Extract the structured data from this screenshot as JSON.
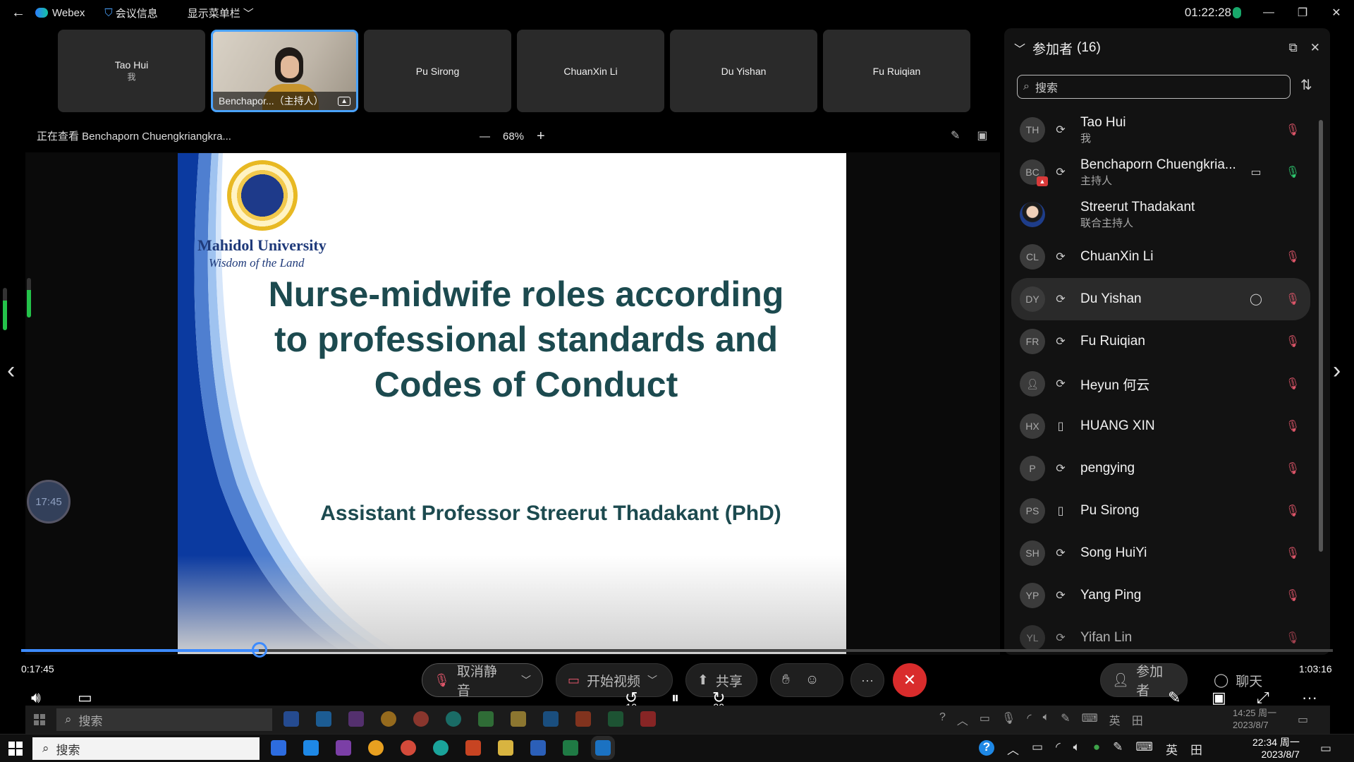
{
  "topbar": {
    "back_icon": "back-arrow-icon",
    "app_name": "Webex",
    "meeting_info": "会议信息",
    "show_menu": "显示菜单栏",
    "time": "01:22:28"
  },
  "thumbnails": [
    {
      "name": "Tao Hui",
      "sub": "我"
    },
    {
      "name": "Benchapor...（主持人）",
      "sub": ""
    },
    {
      "name": "Pu Sirong",
      "sub": ""
    },
    {
      "name": "ChuanXin Li",
      "sub": ""
    },
    {
      "name": "Du Yishan",
      "sub": ""
    },
    {
      "name": "Fu Ruiqian",
      "sub": ""
    }
  ],
  "view": {
    "viewing": "正在查看 Benchaporn Chuengkriangkra...",
    "zoom": "68%"
  },
  "slide": {
    "university": "Mahidol University",
    "motto": "Wisdom of the Land",
    "title_lines": [
      "Nurse-midwife roles according",
      "to professional standards and",
      "Codes of Conduct"
    ],
    "author": "Assistant Professor Streerut Thadakant (PhD)"
  },
  "timer_bubble": "17:45",
  "panel": {
    "title": "参加者",
    "count": "(16)",
    "search_placeholder": "搜索",
    "participants": [
      {
        "initials": "TH",
        "name": "Tao Hui",
        "role": "我",
        "device": "sync",
        "mic": "muted"
      },
      {
        "initials": "BC",
        "name": "Benchaporn Chuengkria...",
        "role": "主持人",
        "device": "sync",
        "mic": "on",
        "extra": "video"
      },
      {
        "initials": "",
        "name": "Streerut Thadakant",
        "role": "联合主持人",
        "device": "",
        "mic": ""
      },
      {
        "initials": "CL",
        "name": "ChuanXin Li",
        "role": "",
        "device": "sync",
        "mic": "muted"
      },
      {
        "initials": "DY",
        "name": "Du Yishan",
        "role": "",
        "device": "sync",
        "mic": "muted",
        "extra": "chat"
      },
      {
        "initials": "FR",
        "name": "Fu Ruiqian",
        "role": "",
        "device": "sync",
        "mic": "muted"
      },
      {
        "initials": "",
        "name": "Heyun 何云",
        "role": "",
        "device": "sync",
        "mic": "muted"
      },
      {
        "initials": "HX",
        "name": "HUANG XIN",
        "role": "",
        "device": "phone",
        "mic": "muted"
      },
      {
        "initials": "P",
        "name": "pengying",
        "role": "",
        "device": "sync",
        "mic": "muted"
      },
      {
        "initials": "PS",
        "name": "Pu Sirong",
        "role": "",
        "device": "phone",
        "mic": "muted"
      },
      {
        "initials": "SH",
        "name": "Song HuiYi",
        "role": "",
        "device": "sync",
        "mic": "muted"
      },
      {
        "initials": "YP",
        "name": "Yang Ping",
        "role": "",
        "device": "sync",
        "mic": "muted"
      },
      {
        "initials": "YL",
        "name": "Yifan Lin",
        "role": "",
        "device": "sync",
        "mic": "muted"
      }
    ]
  },
  "player": {
    "elapsed": "0:17:45",
    "total": "1:03:16",
    "progress": 0.181,
    "rewind": "10",
    "forward": "30"
  },
  "controls": {
    "unmute": "取消静音",
    "start_video": "开始视频",
    "share": "共享",
    "participants": "参加者",
    "chat": "聊天"
  },
  "taskbar_inner": {
    "search": "搜索",
    "lang": "英",
    "time": "14:25 周一",
    "date": "2023/8/7"
  },
  "taskbar": {
    "search": "搜索",
    "lang": "英",
    "time": "22:34 周一",
    "date": "2023/8/7"
  }
}
